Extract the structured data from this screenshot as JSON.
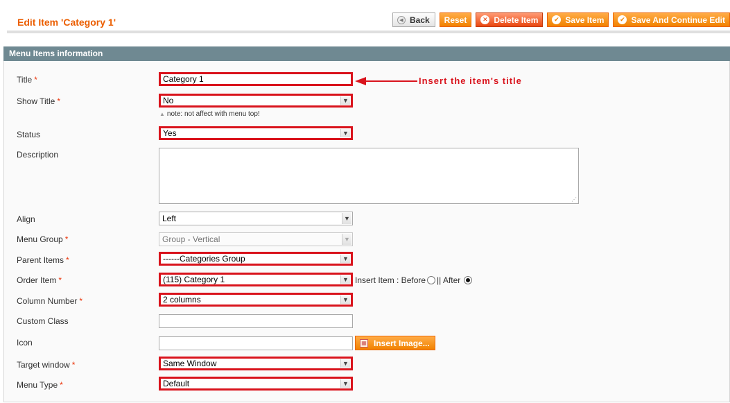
{
  "page": {
    "title": "Edit Item 'Category 1'"
  },
  "buttons": {
    "back": "Back",
    "reset": "Reset",
    "delete": "Delete Item",
    "save": "Save Item",
    "save_continue": "Save And Continue Edit"
  },
  "section": {
    "title": "Menu Items information"
  },
  "annotation": "Insert the item's title",
  "fields": {
    "title": {
      "label": "Title",
      "value": "Category 1"
    },
    "show_title": {
      "label": "Show Title",
      "value": "No",
      "note": "note: not affect with menu top!"
    },
    "status": {
      "label": "Status",
      "value": "Yes"
    },
    "description": {
      "label": "Description",
      "value": ""
    },
    "align": {
      "label": "Align",
      "value": "Left"
    },
    "menu_group": {
      "label": "Menu Group",
      "value": "Group - Vertical"
    },
    "parent_items": {
      "label": "Parent Items",
      "value": "------Categories Group"
    },
    "order_item": {
      "label": "Order Item",
      "value": "(115) Category 1",
      "insert_label": "Insert Item : Before",
      "or_label": "|| After"
    },
    "column_number": {
      "label": "Column Number",
      "value": "2 columns"
    },
    "custom_class": {
      "label": "Custom Class",
      "value": ""
    },
    "icon": {
      "label": "Icon",
      "value": "",
      "insert_button": "Insert Image..."
    },
    "target_window": {
      "label": "Target window",
      "value": "Same Window"
    },
    "menu_type": {
      "label": "Menu Type",
      "value": "Default"
    }
  },
  "required_mark": "*",
  "colors": {
    "accent": "#eb5e00",
    "highlight": "#d9131c",
    "section_head": "#6f8992"
  }
}
